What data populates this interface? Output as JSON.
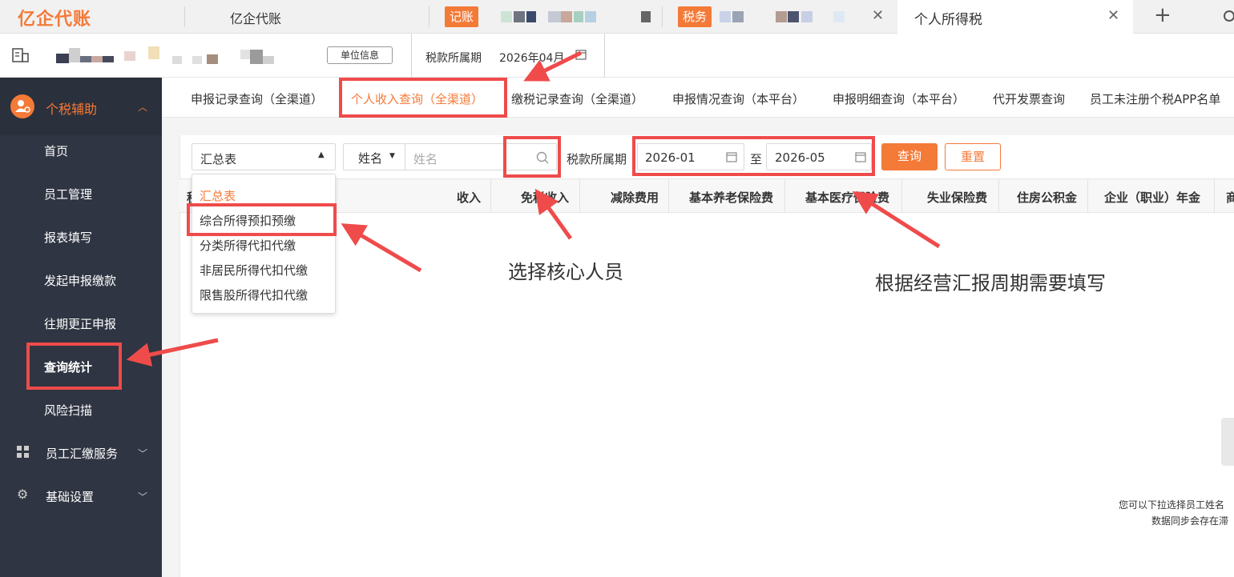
{
  "tabbar": {
    "logo": "亿企代账",
    "app_title": "亿企代账",
    "tab1_badge": "记账",
    "tab2_badge": "税务",
    "active_tab": "个人所得税",
    "new_tab_icon": "plus-icon",
    "search_icon": "search-icon"
  },
  "header": {
    "unit_info_button": "单位信息",
    "period_label": "税款所属期",
    "period_value": "2026年04月"
  },
  "sidebar": {
    "section1": "个税辅助",
    "items": [
      "首页",
      "员工管理",
      "报表填写",
      "发起申报缴款",
      "往期更正申报",
      "查询统计",
      "风险扫描"
    ],
    "section2": "员工汇缴服务",
    "section3": "基础设置",
    "active_item": "查询统计"
  },
  "nav_tabs": [
    "申报记录查询（全渠道）",
    "个人收入查询（全渠道）",
    "缴税记录查询（全渠道）",
    "申报情况查询（本平台）",
    "申报明细查询（本平台）",
    "代开发票查询",
    "员工未注册个税APP名单"
  ],
  "filters": {
    "report_select_value": "汇总表",
    "name_type": "姓名",
    "name_placeholder": "姓名",
    "period_label": "税款所属期",
    "start_date": "2026-01",
    "to_label": "至",
    "end_date": "2026-05",
    "query_button": "查询",
    "reset_button": "重置"
  },
  "dropdown_options": [
    "汇总表",
    "综合所得预扣预缴",
    "分类所得代扣代缴",
    "非居民所得代扣代缴",
    "限售股所得代扣代缴"
  ],
  "table_headers": [
    "收入",
    "免税收入",
    "减除费用",
    "基本养老保险费",
    "基本医疗保险费",
    "失业保险费",
    "住房公积金",
    "企业（职业）年金",
    "商"
  ],
  "annotations": {
    "select_core": "选择核心人员",
    "fill_period": "根据经营汇报周期需要填写"
  },
  "empty_hint": {
    "line1": "您可以下拉选择员工姓名",
    "line2": "数据同步会存在滞"
  },
  "colors": {
    "accent": "#f47a38",
    "sidebar_bg": "#2f3542",
    "annotation_red": "#ef4b4b"
  }
}
